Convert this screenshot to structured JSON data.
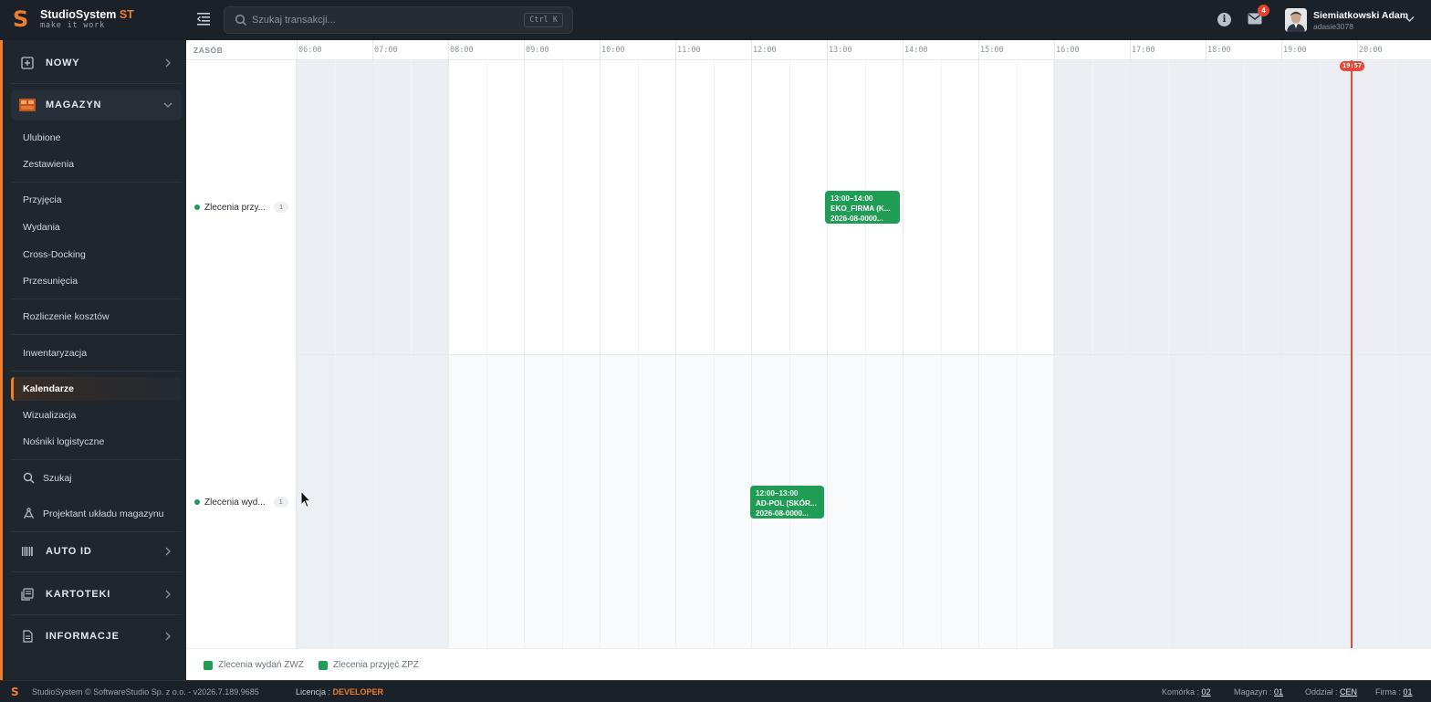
{
  "brand": {
    "name": "StudioSystem",
    "name_suffix": "ST",
    "tagline": "make it work",
    "logo": "S",
    "accent": "#f07d2c"
  },
  "search": {
    "placeholder": "Szukaj transakcji...",
    "shortcut": "Ctrl K"
  },
  "topbar": {
    "notifications_count": "4",
    "info_icon": "info-icon",
    "mail_icon": "mail-icon"
  },
  "user": {
    "name": "Siemiatkowski Adam",
    "login": "adasie3078"
  },
  "sidebar": {
    "nowy": "NOWY",
    "magazyn": "MAGAZYN",
    "items": [
      "Ulubione",
      "Zestawienia",
      "Przyjęcia",
      "Wydania",
      "Cross-Docking",
      "Przesunięcia",
      "Rozliczenie kosztów",
      "Inwentaryzacja",
      "Kalendarze",
      "Wizualizacja",
      "Nośniki logistyczne"
    ],
    "search": "Szukaj",
    "designer": "Projektant układu magazynu",
    "auto_id": "AUTO ID",
    "kartoteki": "KARTOTEKI",
    "informacje": "INFORMACJE",
    "active_item": "Kalendarze"
  },
  "calendar": {
    "resource_header": "ZASÓB",
    "hours": [
      "06:00",
      "07:00",
      "08:00",
      "09:00",
      "10:00",
      "11:00",
      "12:00",
      "13:00",
      "14:00",
      "15:00",
      "16:00",
      "17:00",
      "18:00",
      "19:00",
      "20:00"
    ],
    "working_hours": {
      "start": "08:00",
      "end": "16:00"
    },
    "now": "19:57",
    "resources": [
      {
        "label": "Zlecenia przy...",
        "count": "1"
      },
      {
        "label": "Zlecenia wyd...",
        "count": "1"
      }
    ],
    "events": [
      {
        "time": "13:00–14:00",
        "title": "EKO_FIRMA (K...",
        "doc": "2026-08-0000...",
        "color": "#1f9d55"
      },
      {
        "time": "12:00–13:00",
        "title": "AD-POL (SKÓR...",
        "doc": "2026-08-0000...",
        "color": "#1f9d55"
      }
    ],
    "legend": [
      {
        "label": "Zlecenia wydań ZWZ",
        "color": "#1f9d55"
      },
      {
        "label": "Zlecenia przyjęć ZPZ",
        "color": "#1f9d55"
      }
    ]
  },
  "footer": {
    "copyright": "StudioSystem © SoftwareStudio Sp. z o.o. - v2026.7.189.9685",
    "license_label": "Licencja :",
    "license_value": "DEVELOPER",
    "komorka_label": "Komórka :",
    "komorka_value": "02",
    "magazyn_label": "Magazyn :",
    "magazyn_value": "01",
    "oddzial_label": "Oddział :",
    "oddzial_value": "CEN",
    "firma_label": "Firma :",
    "firma_value": "01"
  }
}
